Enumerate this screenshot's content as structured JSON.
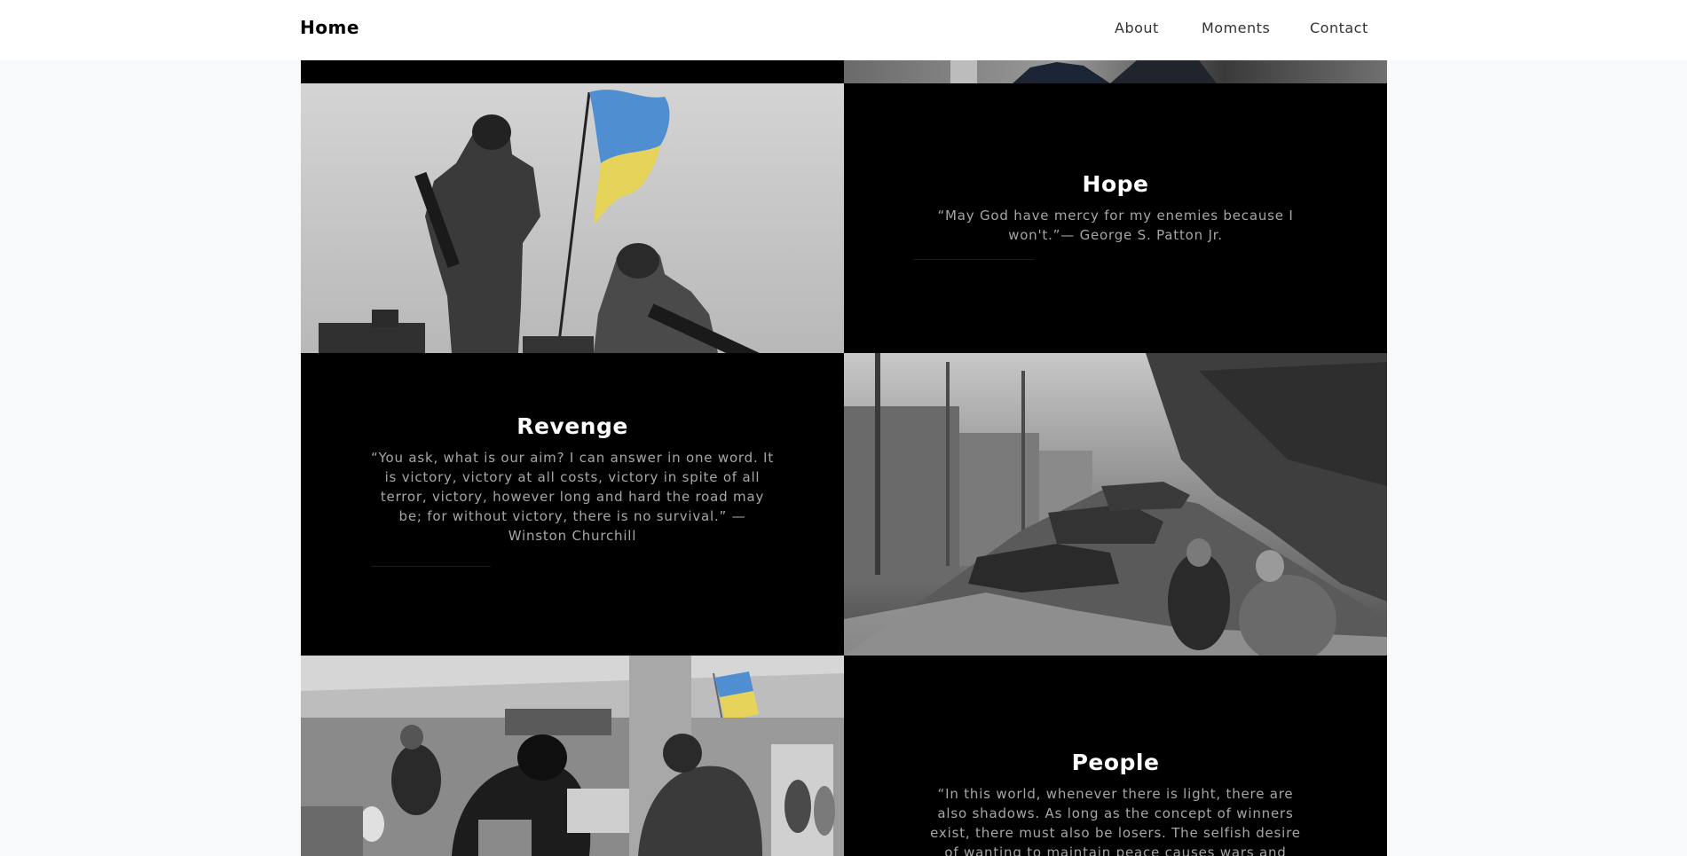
{
  "nav": {
    "brand": "Home",
    "links": [
      "About",
      "Moments",
      "Contact"
    ]
  },
  "sections": [
    {
      "title": "Hope",
      "quote": "“May God have mercy for my enemies because I won't.”— George S. Patton Jr."
    },
    {
      "title": "Revenge",
      "quote": "“You ask, what is our aim? I can answer in one word. It is victory, victory at all costs, victory in spite of all terror, victory, however long and hard the road may be; for without victory, there is no survival.” — Winston Churchill"
    },
    {
      "title": "People",
      "quote": "“In this world, whenever there is light, there are also shadows. As long as the concept of winners exist, there must also be losers. The selfish desire of wanting to maintain peace causes wars and hatred is here to protect"
    }
  ],
  "colors": {
    "flag_blue": "#4f8fd1",
    "flag_yellow": "#e6d35a",
    "page_bg": "#f8f9fa"
  }
}
